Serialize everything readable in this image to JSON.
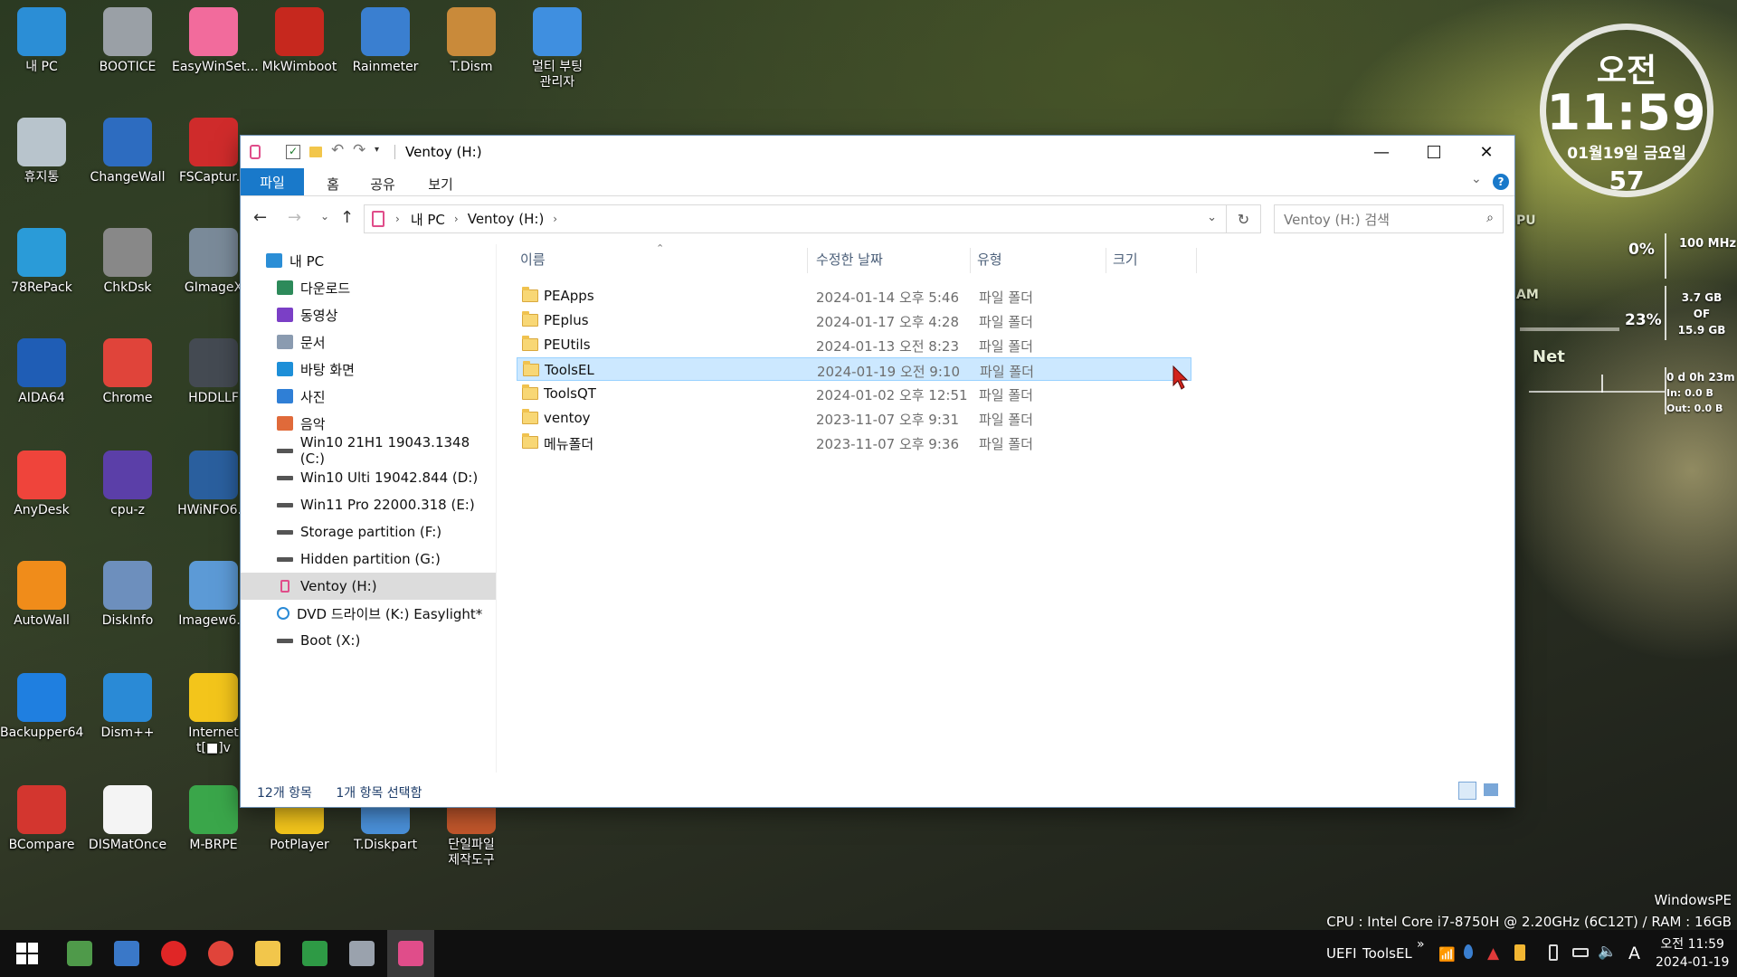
{
  "desktop_icons": [
    {
      "label": "내 PC",
      "icon": "monitor-icon",
      "color": "#2b8ed6"
    },
    {
      "label": "BOOTICE",
      "icon": "bootice-icon",
      "color": "#9aa0a6"
    },
    {
      "label": "EasyWinSet...",
      "icon": "windows-tiles-icon",
      "color": "#f26b9c"
    },
    {
      "label": "MkWimboot",
      "icon": "ladybug-icon",
      "color": "#c6281e"
    },
    {
      "label": "Rainmeter",
      "icon": "drop-icon",
      "color": "#3a7fd0"
    },
    {
      "label": "T.Dism",
      "icon": "box-disc-icon",
      "color": "#c98a3a"
    },
    {
      "label": "멀티 부팅\n관리자",
      "icon": "refresh-icon",
      "color": "#3f8fe0"
    },
    {
      "label": "휴지통",
      "icon": "recycle-bin-icon",
      "color": "#b8c4cc"
    },
    {
      "label": "ChangeWall",
      "icon": "monitor-check-icon",
      "color": "#2d6cc0"
    },
    {
      "label": "FSCaptur...",
      "icon": "capture-icon",
      "color": "#cf2b2b"
    },
    {
      "label": "78RePack",
      "icon": "triangle-icon",
      "color": "#2a9bd8"
    },
    {
      "label": "ChkDsk",
      "icon": "drive-icon",
      "color": "#888888"
    },
    {
      "label": "GImageX",
      "icon": "drive-stack-icon",
      "color": "#7a8a99"
    },
    {
      "label": "AIDA64",
      "icon": "aida64-icon",
      "color": "#1f5db5"
    },
    {
      "label": "Chrome",
      "icon": "chrome-icon",
      "color": "#e0443a"
    },
    {
      "label": "HDDLLF",
      "icon": "hdd-icon",
      "color": "#444a52"
    },
    {
      "label": "AnyDesk",
      "icon": "anydesk-icon",
      "color": "#ef443b"
    },
    {
      "label": "cpu-z",
      "icon": "cpu-icon",
      "color": "#5b3fa8"
    },
    {
      "label": "HWiNFO6...",
      "icon": "hwinfo-icon",
      "color": "#2a5f9e"
    },
    {
      "label": "AutoWall",
      "icon": "play-icon",
      "color": "#f08c1a"
    },
    {
      "label": "DiskInfo",
      "icon": "disk-search-icon",
      "color": "#6d8fbd"
    },
    {
      "label": "Imagew6...",
      "icon": "imagew-icon",
      "color": "#5c9ad6"
    },
    {
      "label": "Backupper64",
      "icon": "backup-icon",
      "color": "#1f7fe0"
    },
    {
      "label": "Dism++",
      "icon": "gears-icon",
      "color": "#2a8ad6"
    },
    {
      "label": "Internet\nt[■]v",
      "icon": "player-icon",
      "color": "#f3c51b"
    },
    {
      "label": "BCompare",
      "icon": "bcompare-icon",
      "color": "#d3362f"
    },
    {
      "label": "DISMatOnce",
      "icon": "d-letter-icon",
      "color": "#f4f4f4"
    },
    {
      "label": "M-BRPE",
      "icon": "pcb-icon",
      "color": "#3aa64a"
    },
    {
      "label": "PotPlayer",
      "icon": "player-icon",
      "color": "#f3c51b"
    },
    {
      "label": "T.Diskpart",
      "icon": "window-icon",
      "color": "#4a90d9"
    },
    {
      "label": "단일파일\n제작도구",
      "icon": "package-icon",
      "color": "#c0562b"
    }
  ],
  "clock": {
    "ampm": "오전",
    "time": "11:59",
    "date": "01월19일 금요일",
    "seconds": "57"
  },
  "monitor": {
    "cpu_label": "PU",
    "cpu_pct": "0%",
    "cpu_freq": "100 MHz",
    "ram_label": "AM",
    "ram_pct": "23%",
    "ram_used": "3.7 GB",
    "ram_of": "OF",
    "ram_total": "15.9 GB",
    "net_label": "Net",
    "uptime": "0 d 0h 23m",
    "net_in": "In: 0.0 B",
    "net_out": "Out: 0.0 B"
  },
  "window": {
    "title": "Ventoy (H:)",
    "ribbon_tabs": [
      "파일",
      "홈",
      "공유",
      "보기"
    ],
    "breadcrumb": [
      "내 PC",
      "Ventoy (H:)"
    ],
    "search_placeholder": "Ventoy (H:) 검색",
    "columns": [
      "이름",
      "수정한 날짜",
      "유형",
      "크기"
    ],
    "nav_items": [
      {
        "label": "내 PC",
        "icon": "pc-icon"
      },
      {
        "label": "다운로드",
        "icon": "download-icon"
      },
      {
        "label": "동영상",
        "icon": "video-icon"
      },
      {
        "label": "문서",
        "icon": "document-icon"
      },
      {
        "label": "바탕 화면",
        "icon": "desktop-icon"
      },
      {
        "label": "사진",
        "icon": "picture-icon"
      },
      {
        "label": "음악",
        "icon": "music-icon"
      },
      {
        "label": "Win10 21H1 19043.1348 (C:)",
        "icon": "drive-icon"
      },
      {
        "label": "Win10 Ulti 19042.844 (D:)",
        "icon": "drive-icon"
      },
      {
        "label": "Win11 Pro 22000.318 (E:)",
        "icon": "drive-icon"
      },
      {
        "label": "Storage partition (F:)",
        "icon": "drive-icon"
      },
      {
        "label": "Hidden partition (G:)",
        "icon": "drive-icon"
      },
      {
        "label": "Ventoy (H:)",
        "icon": "usb-icon"
      },
      {
        "label": "DVD 드라이브 (K:) Easylight*",
        "icon": "dvd-icon"
      },
      {
        "label": "Boot (X:)",
        "icon": "drive-icon"
      }
    ],
    "selected_nav_index": 12,
    "files": [
      {
        "name": "PEApps",
        "date": "2024-01-14 오후 5:46",
        "type": "파일 폴더",
        "selected": false
      },
      {
        "name": "PEplus",
        "date": "2024-01-17 오후 4:28",
        "type": "파일 폴더",
        "selected": false
      },
      {
        "name": "PEUtils",
        "date": "2024-01-13 오전 8:23",
        "type": "파일 폴더",
        "selected": false
      },
      {
        "name": "ToolsEL",
        "date": "2024-01-19 오전 9:10",
        "type": "파일 폴더",
        "selected": true
      },
      {
        "name": "ToolsQT",
        "date": "2024-01-02 오후 12:51",
        "type": "파일 폴더",
        "selected": false
      },
      {
        "name": "ventoy",
        "date": "2023-11-07 오후 9:31",
        "type": "파일 폴더",
        "selected": false
      },
      {
        "name": "메뉴폴더",
        "date": "2023-11-07 오후 9:36",
        "type": "파일 폴더",
        "selected": false
      }
    ],
    "status_count": "12개 항목",
    "status_selected": "1개 항목 선택함"
  },
  "sysinfo": {
    "os": "WindowsPE",
    "cpu_line": "CPU : Intel Core i7-8750H @ 2.20GHz (6C12T) / RAM : 16GB"
  },
  "taskbar": {
    "apps": [
      {
        "icon": "windows-start-icon",
        "color": "#ffffff"
      },
      {
        "icon": "pcb-icon",
        "color": "#4f9a4a"
      },
      {
        "icon": "monitor-check-icon",
        "color": "#3a78c8"
      },
      {
        "icon": "power-icon",
        "color": "#e02626"
      },
      {
        "icon": "chrome-icon",
        "color": "#e0443a"
      },
      {
        "icon": "folder-icon",
        "color": "#f2c64b"
      },
      {
        "icon": "spreadsheet-icon",
        "color": "#2e9a45"
      },
      {
        "icon": "rocket-icon",
        "color": "#9aa2ad"
      },
      {
        "icon": "usb-icon",
        "color": "#e04d8a"
      }
    ],
    "tray_label_uefi": "UEFI",
    "tray_label_tool": "ToolsEL",
    "tray_chevron": "»",
    "ime": "A",
    "time": "오전 11:59",
    "date": "2024-01-19"
  }
}
